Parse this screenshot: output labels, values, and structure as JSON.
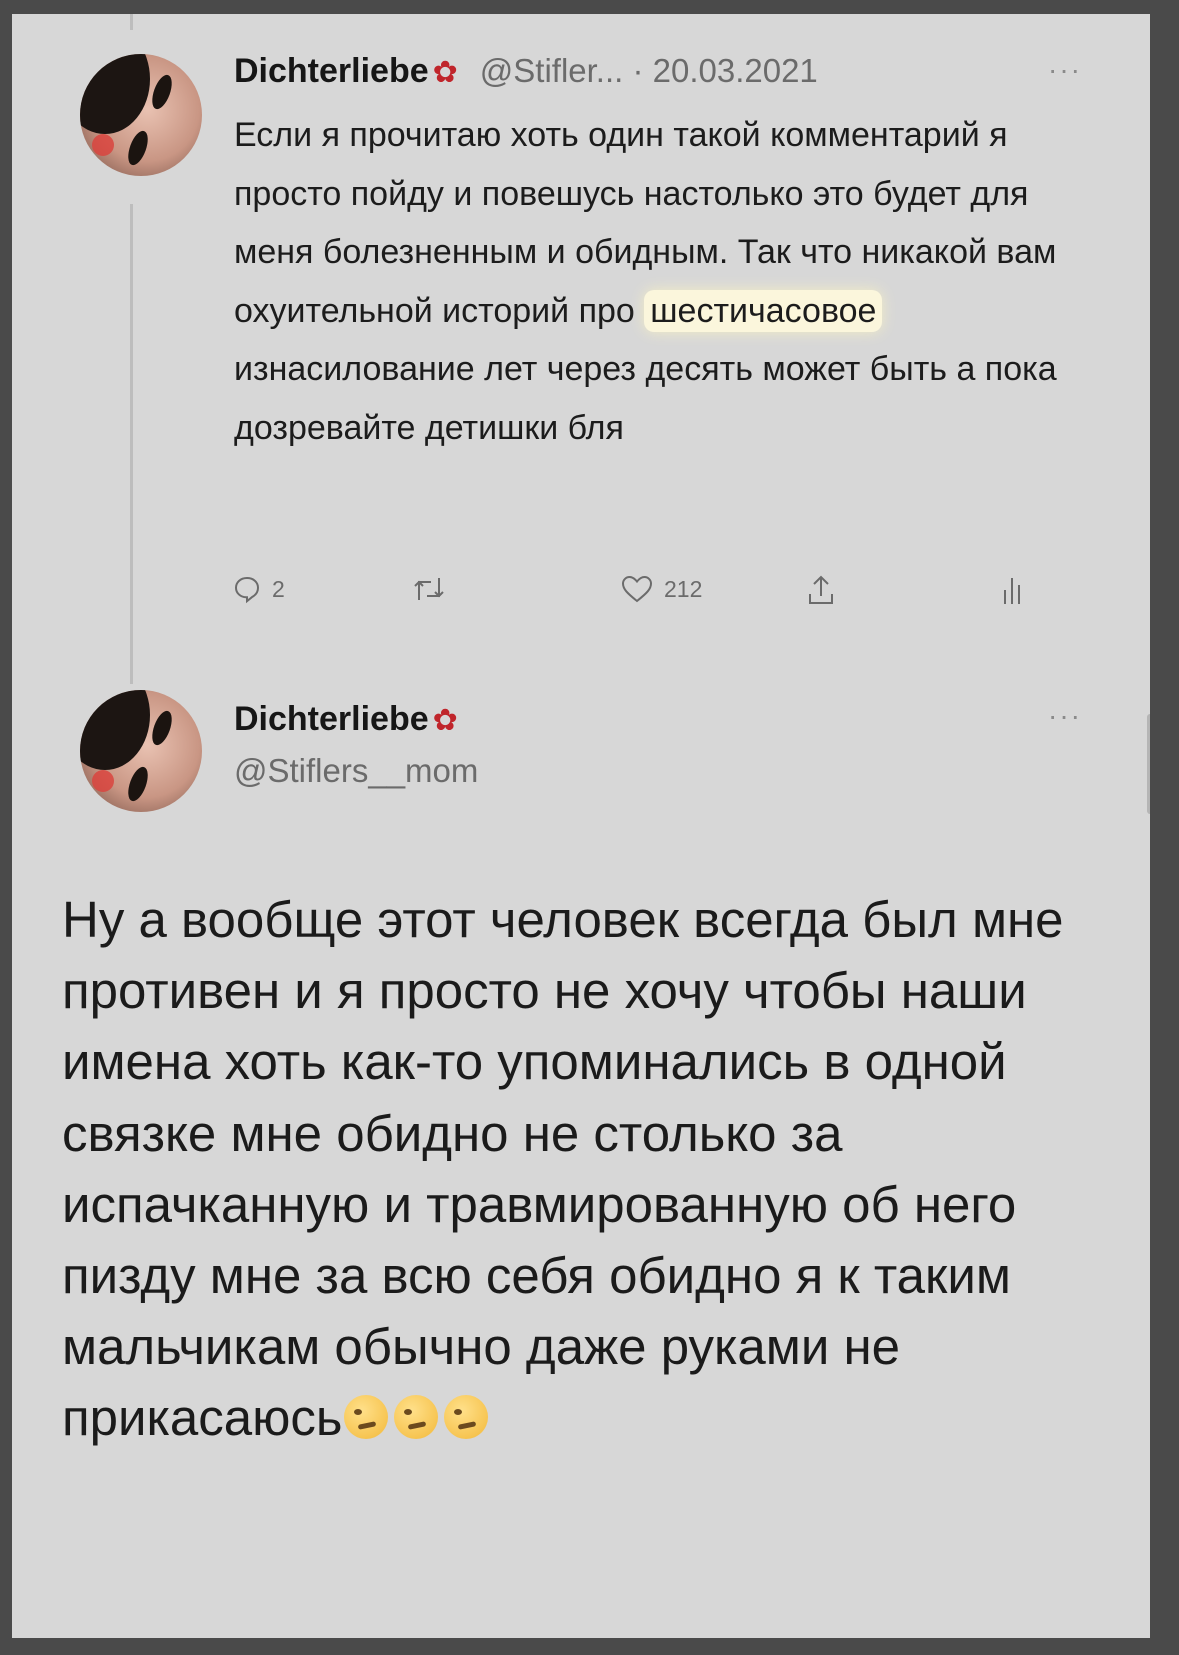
{
  "tweet1": {
    "display_name": "Dichterliebe",
    "name_emoji": "✿",
    "handle_date": "@Stifler... · 20.03.2021",
    "more": "···",
    "text_before": "Если я прочитаю хоть один такой комментарий я просто пойду и повешусь настолько это будет для меня болезненным и обидным. Так что никакой вам охуительной историй про ",
    "text_highlight": "шестичасовое",
    "text_after": " изнасилование лет через десять может быть а пока дозревайте детишки бля",
    "replies": "2",
    "likes": "212",
    "icons": [
      "reply-icon",
      "retweet-icon",
      "like-icon",
      "share-icon",
      "analytics-icon"
    ]
  },
  "tweet2": {
    "display_name": "Dichterliebe",
    "name_emoji": "✿",
    "handle": "@Stiflers__mom",
    "more": "···",
    "text": "Ну а вообще этот человек всегда был мне противен и я просто не хочу чтобы наши имена хоть как-то упоминались в одной связке мне обидно не столько за испачканную и травмированную об него пизду мне за всю себя обидно я к таким мальчикам обычно даже руками не прикасаюсь",
    "trailing_emoji": [
      "woozy-face-emoji",
      "woozy-face-emoji",
      "woozy-face-emoji"
    ]
  },
  "colors": {
    "background": "#d7d7d7",
    "outer": "#4a4a4a",
    "text": "#1c1c1c",
    "muted": "#6b6b6b",
    "highlight": "#fbf6dc",
    "flower": "#c0252b"
  }
}
